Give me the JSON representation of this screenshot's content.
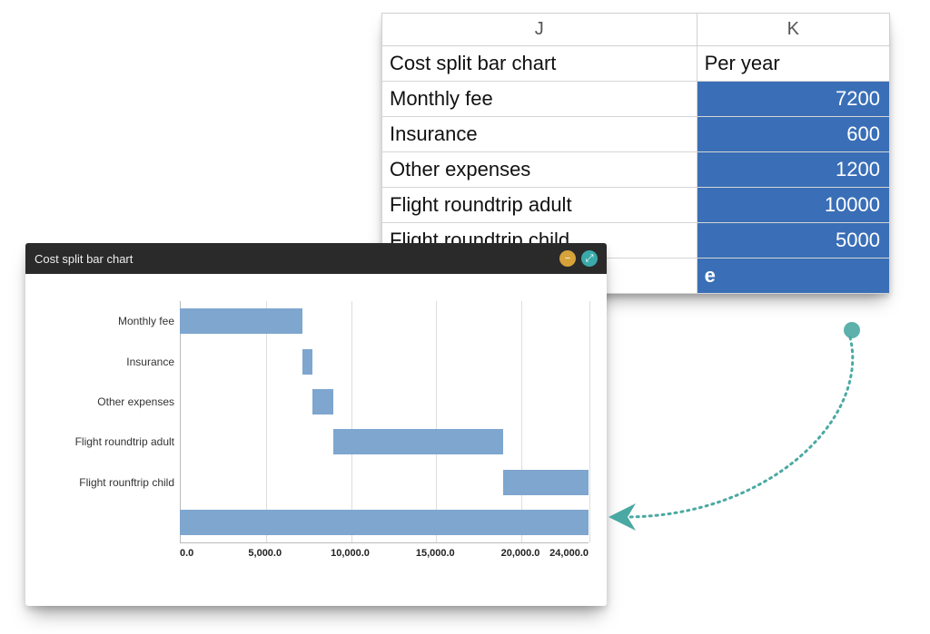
{
  "sheet": {
    "col_headers": [
      "J",
      "K"
    ],
    "title_row": {
      "label": "Cost split bar chart",
      "value": "Per year"
    },
    "rows": [
      {
        "label": "Monthly fee",
        "value": "7200"
      },
      {
        "label": "Insurance",
        "value": "600"
      },
      {
        "label": "Other expenses",
        "value": "1200"
      },
      {
        "label": "Flight roundtrip adult",
        "value": "10000"
      },
      {
        "label": "Flight roundtrip child",
        "value": "5000"
      }
    ],
    "tail_cell": "e"
  },
  "chart_header": {
    "title": "Cost split bar chart",
    "buttons": {
      "minimize": "−",
      "fullscreen": "⤢"
    }
  },
  "chart_data": {
    "type": "bar",
    "orientation": "horizontal",
    "stacked_waterfall": true,
    "categories": [
      "Monthly fee",
      "Insurance",
      "Other expenses",
      "Flight roundtrip adult",
      "Flight rounftrip child",
      ""
    ],
    "series": [
      {
        "name": "offset",
        "values": [
          0,
          7200,
          7800,
          9000,
          19000,
          0
        ],
        "color": "transparent"
      },
      {
        "name": "value",
        "values": [
          7200,
          600,
          1200,
          10000,
          5000,
          24000
        ],
        "color": "#7ea6cf"
      }
    ],
    "title": "Cost split bar chart",
    "xlabel": "",
    "ylabel": "",
    "xlim": [
      0,
      24000
    ],
    "x_ticks": [
      0,
      5000,
      10000,
      15000,
      20000,
      24000
    ],
    "x_tick_labels": [
      "0.0",
      "5,000.0",
      "10,000.0",
      "15,000.0",
      "20,000.0",
      "24,000.0"
    ]
  },
  "colors": {
    "bar": "#7ea6cf",
    "cell_highlight": "#3a6fb7",
    "arrow": "#4aa9a3"
  }
}
